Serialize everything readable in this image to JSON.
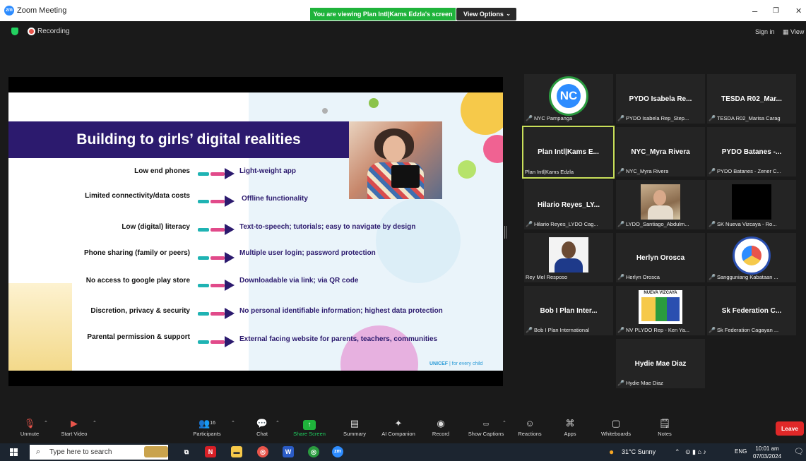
{
  "window": {
    "title": "Zoom Meeting",
    "app_icon": "zm",
    "share_banner": "You are viewing Plan Intl|Kams Edzla's screen",
    "view_options": "View Options",
    "controls": [
      "–",
      "❐",
      "✕"
    ]
  },
  "header": {
    "recording": "Recording",
    "sign_in": "Sign in",
    "view": "View"
  },
  "slide": {
    "title": "Building to girls’ digital realities",
    "rows": [
      {
        "left": "Low end phones",
        "right": "Light-weight app"
      },
      {
        "left": "Limited connectivity/data costs",
        "right": "Offline functionality"
      },
      {
        "left": "Low (digital) literacy",
        "right": "Text-to-speech; tutorials; easy to navigate by design"
      },
      {
        "left": "Phone sharing (family or peers)",
        "right": "Multiple user login; password protection"
      },
      {
        "left": "No access to google play store",
        "right": "Downloadable via link; via QR code"
      },
      {
        "left": "Discretion, privacy & security",
        "right": "No personal identifiable information; highest data protection"
      },
      {
        "left": "Parental permission & support",
        "right": "External facing website for parents, teachers, communities"
      }
    ],
    "footer_brand": "UNICEF",
    "footer_tag": " | for every child"
  },
  "participants": [
    {
      "big": "",
      "label": "NYC Pampanga",
      "muted": true,
      "pic": "nc-logo"
    },
    {
      "big": "PYDO Isabela Re...",
      "label": "PYDO Isabela Rep_Step...",
      "muted": true
    },
    {
      "big": "TESDA R02_Mar...",
      "label": "TESDA R02_Marisa Carag",
      "muted": true
    },
    {
      "big": "Plan Intl|Kams E...",
      "label": "Plan Intl|Kams Edzla",
      "muted": false,
      "active": true
    },
    {
      "big": "NYC_Myra Rivera",
      "label": "NYC_Myra Rivera",
      "muted": true
    },
    {
      "big": "PYDO Batanes -...",
      "label": "PYDO Batanes - Zener C...",
      "muted": true
    },
    {
      "big": "Hilario Reyes_LY...",
      "label": "Hilario Reyes_LYDO Cag...",
      "muted": true
    },
    {
      "big": "",
      "label": "LYDO_Santiago_Abdulm...",
      "muted": true,
      "pic": "photo-man"
    },
    {
      "big": "",
      "label": "SK Nueva Vizcaya - Ro...",
      "muted": true,
      "pic": "black"
    },
    {
      "big": "",
      "label": "Rey Mel Resposo",
      "muted": false,
      "pic": "photo-rey"
    },
    {
      "big": "Herlyn Orosca",
      "label": "Herlyn Orosca",
      "muted": true
    },
    {
      "big": "",
      "label": "Sangguniang Kabataan ...",
      "muted": true,
      "pic": "sk-logo"
    },
    {
      "big": "Bob I Plan Inter...",
      "label": "Bob I Plan International",
      "muted": true
    },
    {
      "big": "",
      "label": "NV PLYDO Rep - Ken Ya...",
      "muted": true,
      "pic": "nv-logo",
      "pic_text": "NUEVA VIZCAYA"
    },
    {
      "big": "Sk Federation C...",
      "label": "Sk Federation Cagayan ...",
      "muted": true
    },
    {
      "big": "Hydie Mae Diaz",
      "label": "Hydie Mae Diaz",
      "muted": true
    }
  ],
  "toolbar": {
    "unmute": "Unmute",
    "start_video": "Start Video",
    "participants": "Participants",
    "participants_count": "16",
    "chat": "Chat",
    "share_screen": "Share Screen",
    "summary": "Summary",
    "ai_companion": "AI Companion",
    "record": "Record",
    "show_captions": "Show Captions",
    "reactions": "Reactions",
    "apps": "Apps",
    "whiteboards": "Whiteboards",
    "notes": "Notes",
    "leave": "Leave"
  },
  "taskbar": {
    "search_placeholder": "Type here to search",
    "weather": "31°C  Sunny",
    "lang": "ENG",
    "time": "10:01 am",
    "date": "07/03/2024"
  },
  "colors": {
    "accent_green": "#1fb33b",
    "slide_purple": "#2c1a6e",
    "leave_red": "#e02828",
    "active_tile_border": "#c9e05a"
  }
}
